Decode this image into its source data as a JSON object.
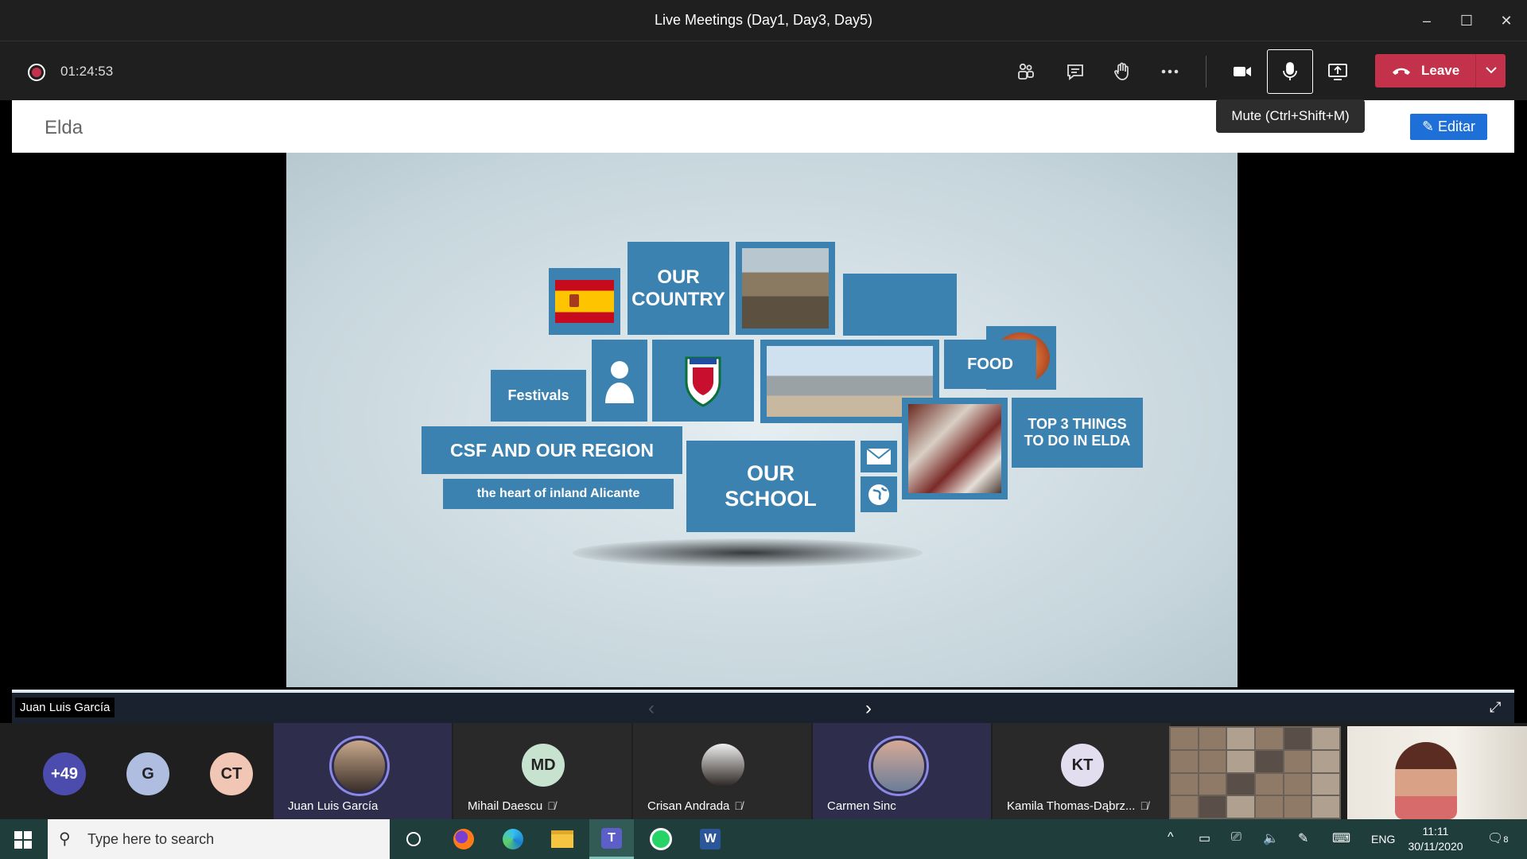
{
  "window": {
    "title": "Live Meetings (Day1, Day3, Day5)",
    "minimize_glyph": "–",
    "maximize_glyph": "☐",
    "close_glyph": "✕"
  },
  "toolbar": {
    "timer": "01:24:53",
    "leave_label": "Leave",
    "tooltip": "Mute (Ctrl+Shift+M)",
    "icons": [
      "participants-icon",
      "chat-icon",
      "raise-hand-icon",
      "more-icon",
      "camera-icon",
      "microphone-icon",
      "share-screen-icon"
    ],
    "accent": "#c4314b"
  },
  "document": {
    "name": "Elda",
    "edit_label": "Editar"
  },
  "slide": {
    "our_country": "OUR COUNTRY",
    "festivals": "Festivals",
    "food": "FOOD",
    "region_title": "CSF AND OUR REGION",
    "region_subtitle": "the heart of inland Alicante",
    "our_school": "OUR SCHOOL",
    "top3": "TOP 3 THINGS TO DO IN ELDA",
    "tile_color": "#3c82b0"
  },
  "presenter": {
    "name": "Juan Luis García"
  },
  "participants": {
    "overflow": "+49",
    "initials": [
      {
        "label": "G",
        "color": "#aebde0"
      },
      {
        "label": "CT",
        "color": "#f2c6b4"
      }
    ],
    "tiles": [
      {
        "name": "Juan Luis García",
        "speaking": true,
        "muted": false
      },
      {
        "name": "Mihail Daescu",
        "initials": "MD",
        "muted": true
      },
      {
        "name": "Crisan Andrada",
        "muted": true
      },
      {
        "name": "Carmen Sinc",
        "speaking": true,
        "muted": false
      },
      {
        "name": "Kamila Thomas-Dąbrz...",
        "initials": "KT",
        "muted": true
      }
    ]
  },
  "taskbar": {
    "search_placeholder": "Type here to search",
    "language": "ENG",
    "time": "11:11",
    "date": "30/11/2020",
    "notifications": "8",
    "apps": [
      "cortana-icon",
      "firefox-icon",
      "edge-icon",
      "file-explorer-icon",
      "teams-icon",
      "whatsapp-icon",
      "word-icon"
    ]
  }
}
